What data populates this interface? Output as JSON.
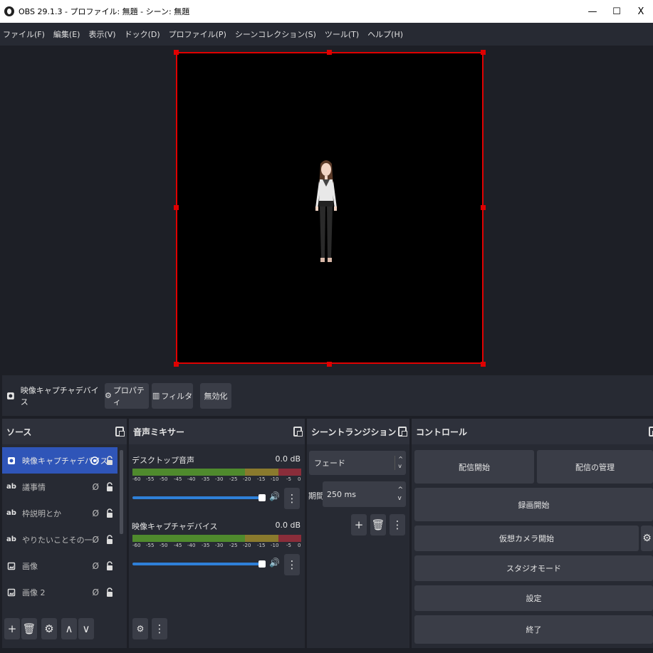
{
  "window": {
    "title": "OBS 29.1.3 - プロファイル: 無題 - シーン: 無題",
    "min": "—",
    "max": "☐",
    "close": "X"
  },
  "menu": [
    "ファイル(F)",
    "編集(E)",
    "表示(V)",
    "ドック(D)",
    "プロファイル(P)",
    "シーンコレクション(S)",
    "ツール(T)",
    "ヘルプ(H)"
  ],
  "source_toolbar": {
    "current": "映像キャプチャデバイス",
    "properties": "プロパティ",
    "filters": "フィルタ",
    "disable": "無効化"
  },
  "sources": {
    "title": "ソース",
    "items": [
      {
        "label": "映像キャプチャデバイス",
        "icon": "camera-icon"
      },
      {
        "label": "議事情",
        "icon": "text-icon",
        "icon_text": "ab"
      },
      {
        "label": "枠説明とか",
        "icon": "text-icon",
        "icon_text": "ab"
      },
      {
        "label": "やりたいことその一",
        "icon": "text-icon",
        "icon_text": "ab"
      },
      {
        "label": "画像",
        "icon": "image-icon"
      },
      {
        "label": "画像 2",
        "icon": "image-icon"
      }
    ]
  },
  "mixer": {
    "title": "音声ミキサー",
    "channels": [
      {
        "name": "デスクトップ音声",
        "db": "0.0 dB"
      },
      {
        "name": "映像キャプチャデバイス",
        "db": "0.0 dB"
      }
    ],
    "ticks": [
      "-60",
      "-55",
      "-50",
      "-45",
      "-40",
      "-35",
      "-30",
      "-25",
      "-20",
      "-15",
      "-10",
      "-5",
      "0"
    ]
  },
  "transitions": {
    "title": "シーントランジション",
    "type": "フェード",
    "duration_label": "期間",
    "duration": "250 ms"
  },
  "controls": {
    "title": "コントロール",
    "start_stream": "配信開始",
    "manage_stream": "配信の管理",
    "start_record": "録画開始",
    "virtual_cam": "仮想カメラ開始",
    "studio_mode": "スタジオモード",
    "settings": "設定",
    "exit": "終了"
  }
}
